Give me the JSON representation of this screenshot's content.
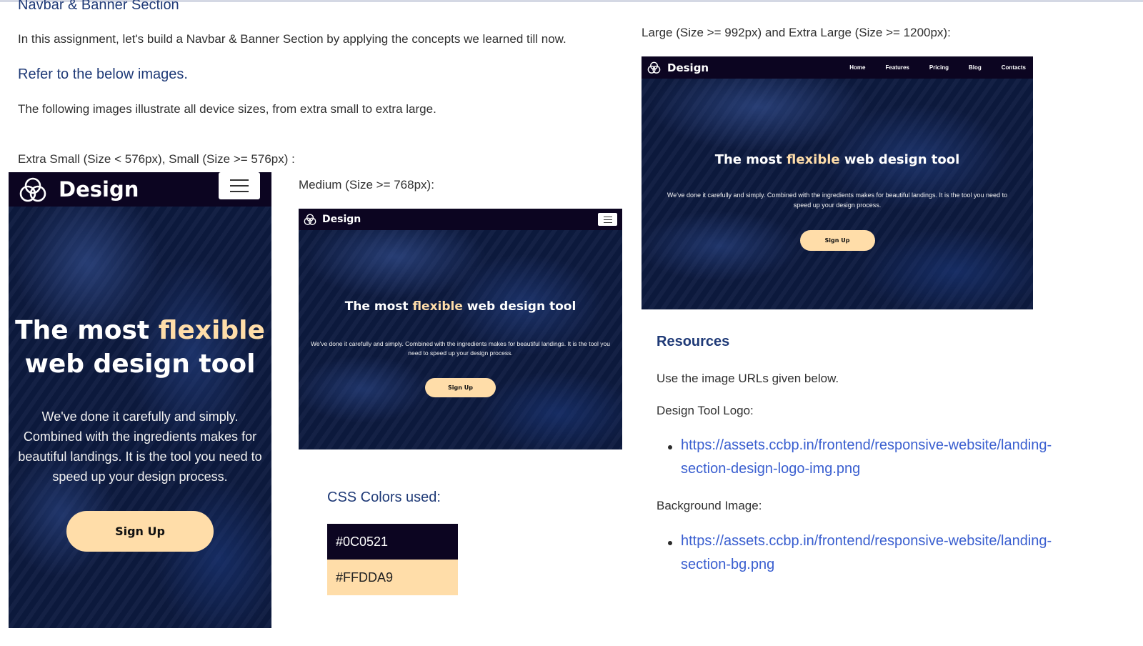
{
  "header": {
    "section_title": "Navbar & Banner Section",
    "intro": "In this assignment, let's build a Navbar & Banner Section by applying the concepts we learned till now.",
    "refer_heading": "Refer to the below images.",
    "device_intro": "The following images illustrate all device sizes, from extra small to extra large."
  },
  "labels": {
    "xs_small": "Extra Small (Size < 576px), Small (Size >= 576px) :",
    "medium": "Medium (Size >= 768px):",
    "large": "Large (Size >= 992px) and Extra Large (Size >= 1200px):"
  },
  "mockup": {
    "logo_text": "Design",
    "title_before": "The most ",
    "title_highlight": "flexible",
    "title_after": " web design tool",
    "title_mobile_line1_before": "The most ",
    "title_mobile_line2": "web design tool",
    "description": "We've done it carefully and simply. Combined with the ingredients makes for beautiful landings. It is the tool you need to speed up your design process.",
    "button_label": "Sign Up",
    "nav_links": [
      "Home",
      "Features",
      "Pricing",
      "Blog",
      "Contacts"
    ]
  },
  "colors": {
    "heading": "CSS Colors used:",
    "primary": "#0C0521",
    "accent": "#FFDDA9"
  },
  "resources": {
    "heading": "Resources",
    "intro": "Use the image URLs given below.",
    "logo_label": "Design Tool Logo:",
    "logo_url_line1": "https://assets.ccbp.in/frontend/responsive-website/landing-",
    "logo_url_line2": "section-design-logo-img.png",
    "bg_label": "Background Image:",
    "bg_url_line1": "https://assets.ccbp.in/frontend/responsive-website/landing-",
    "bg_url_line2": "section-bg.png"
  }
}
